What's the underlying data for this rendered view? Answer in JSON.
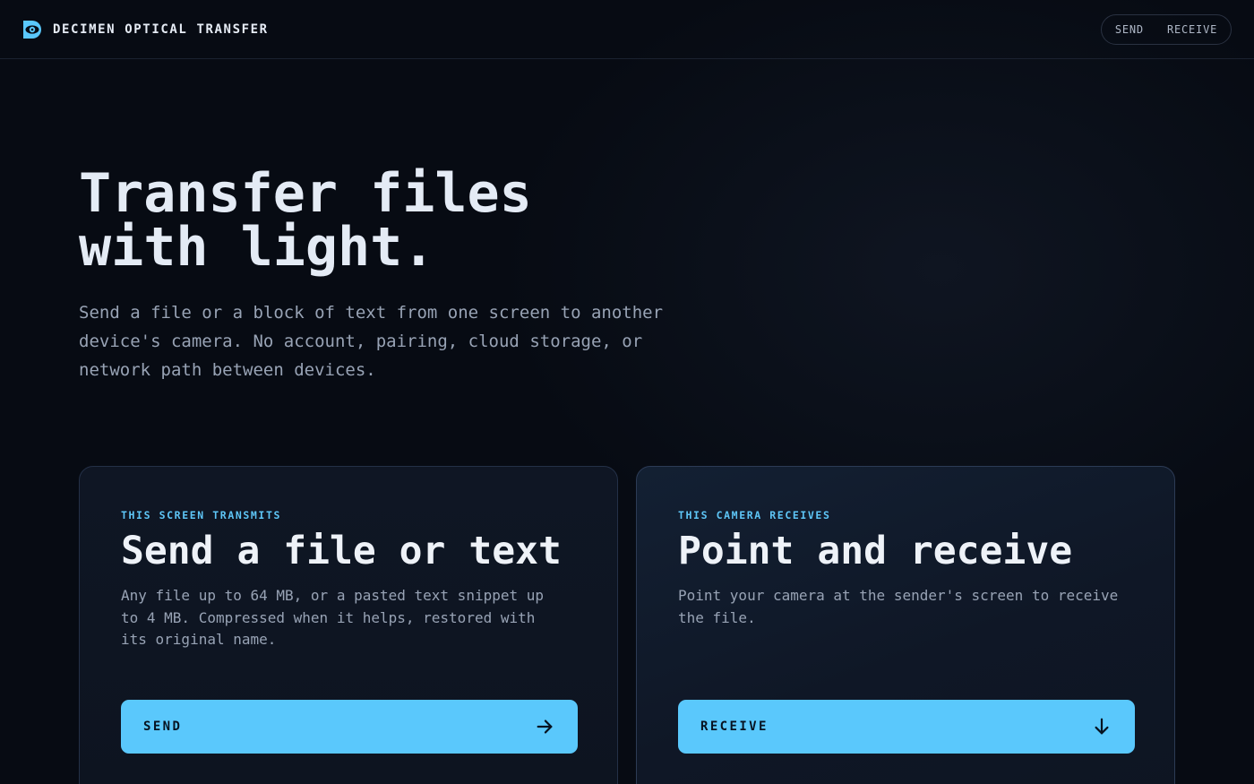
{
  "header": {
    "brand": "DECIMEN OPTICAL TRANSFER",
    "brand_icon": "eye-d-logo-icon",
    "nav": [
      {
        "label": "SEND"
      },
      {
        "label": "RECEIVE"
      }
    ]
  },
  "hero": {
    "title_line1": "Transfer files",
    "title_line2": "with light.",
    "subtitle": "Send a file or a block of text from one screen to another device's camera. No account, pairing, cloud storage, or network path between devices."
  },
  "cards": {
    "send": {
      "eyebrow": "THIS SCREEN TRANSMITS",
      "title": "Send a file or text",
      "text": "Any file up to 64 MB, or a pasted text snippet up to 4 MB. Compressed when it helps, restored with its original name.",
      "button": "SEND",
      "button_icon": "arrow-right-icon"
    },
    "receive": {
      "eyebrow": "THIS CAMERA RECEIVES",
      "title": "Point and receive",
      "text": "Point your camera at the sender's screen to receive the file.",
      "button": "RECEIVE",
      "button_icon": "arrow-down-icon"
    }
  },
  "colors": {
    "background": "#070b13",
    "accent": "#5ac8fc",
    "eyebrow": "#5ec6f7",
    "text_primary": "#e4ebf5",
    "text_secondary": "#98a3b5"
  }
}
